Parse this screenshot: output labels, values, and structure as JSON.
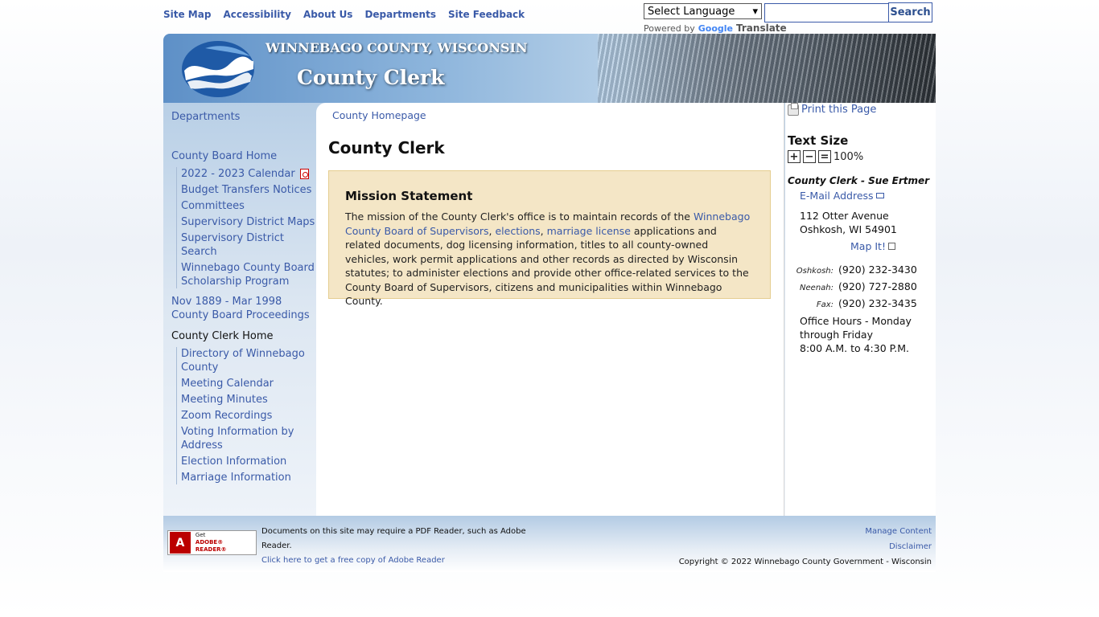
{
  "top_nav": [
    "Site Map",
    "Accessibility",
    "About Us",
    "Departments",
    "Site Feedback"
  ],
  "translate": {
    "select_label": "Select Language",
    "powered_by": "Powered by",
    "google": "Google",
    "translate": "Translate"
  },
  "search": {
    "button": "Search",
    "placeholder": ""
  },
  "banner": {
    "county": "WINNEBAGO COUNTY, WISCONSIN",
    "title": "County Clerk"
  },
  "left_nav": {
    "departments": "Departments",
    "board_home": "County Board Home",
    "board_items": [
      "2022 - 2023 Calendar",
      "Budget Transfers Notices",
      "Committees",
      "Supervisory District Maps",
      "Supervisory District Search",
      "Winnebago County Board Scholarship Program"
    ],
    "proceedings": "Nov 1889 - Mar 1998 County Board Proceedings",
    "clerk_home": "County Clerk Home",
    "clerk_items": [
      "Directory of Winnebago County",
      "Meeting Calendar",
      "Meeting Minutes",
      "Zoom Recordings",
      "Voting Information by Address",
      "Election Information",
      "Marriage Information"
    ]
  },
  "breadcrumb": "County Homepage",
  "page_title": "County Clerk",
  "mission": {
    "heading": "Mission Statement",
    "text_1": "The mission of the County Clerk's office is to maintain records of the ",
    "link_1": "Winnebago County Board of Supervisors",
    "sep_1": ", ",
    "link_2": "elections",
    "sep_2": ", ",
    "link_3": "marriage license",
    "text_2": " applications and related documents, dog licensing information, titles to all county-owned vehicles, work permit applications and other records as directed by Wisconsin statutes; to administer elections and provide other office-related services to the County Board of Supervisors, citizens and municipalities within Winnebago County."
  },
  "sidebar": {
    "print": "Print this Page",
    "text_size_title": "Text Size",
    "text_size_plus": "+",
    "text_size_minus": "−",
    "text_size_reset": "=",
    "text_size_value": "100%",
    "clerk_name": "County Clerk - Sue Ertmer",
    "email": "E-Mail Address",
    "address_1": "112 Otter Avenue",
    "address_2": "Oshkosh, WI 54901",
    "map": "Map It!",
    "phones": [
      {
        "label": "Oshkosh:",
        "number": "(920) 232-3430"
      },
      {
        "label": "Neenah:",
        "number": "(920) 727-2880"
      },
      {
        "label": "Fax:",
        "number": "(920) 232-3435"
      }
    ],
    "hours_1": "Office Hours - Monday through Friday",
    "hours_2": "8:00 A.M. to 4:30 P.M."
  },
  "footer": {
    "adobe_line1": "Get",
    "adobe_line2": "ADOBE® READER®",
    "note": "Documents on this site may require a PDF Reader, such as Adobe Reader.",
    "reader_link": "Click here to get a free copy of Adobe Reader",
    "manage": "Manage Content",
    "disclaimer": "Disclaimer",
    "copyright": "Copyright © 2022 Winnebago County Government - Wisconsin"
  }
}
